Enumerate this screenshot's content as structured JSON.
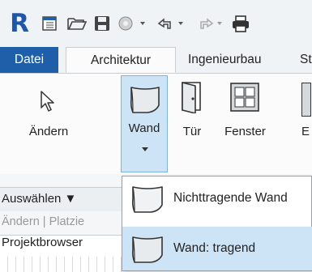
{
  "app": {
    "logo_letter": "R"
  },
  "quick_access": {
    "icons": [
      "open-file-icon",
      "folder-open-icon",
      "save-icon",
      "sync-icon",
      "undo-icon",
      "redo-icon",
      "print-icon"
    ]
  },
  "tabs": [
    "Datei",
    "Architektur",
    "Ingenieurbau",
    "St"
  ],
  "ribbon": {
    "modify_label": "Ändern",
    "wall_label": "Wand",
    "door_label": "Tür",
    "window_label": "Fenster",
    "next_label": "E"
  },
  "panel_bar": {
    "select_label": "Auswählen ▼"
  },
  "options_bar": {
    "text": "Ändern | Platzie"
  },
  "project_browser": {
    "title": "Projektbrowser"
  },
  "wall_menu": {
    "items": [
      {
        "label": "Nichttragende Wand",
        "highlighted": false
      },
      {
        "label": "Wand: tragend",
        "highlighted": true
      }
    ]
  },
  "colors": {
    "accent": "#1f5ea8",
    "highlight": "#cde4f7",
    "highlight_border": "#7fb4e2"
  }
}
